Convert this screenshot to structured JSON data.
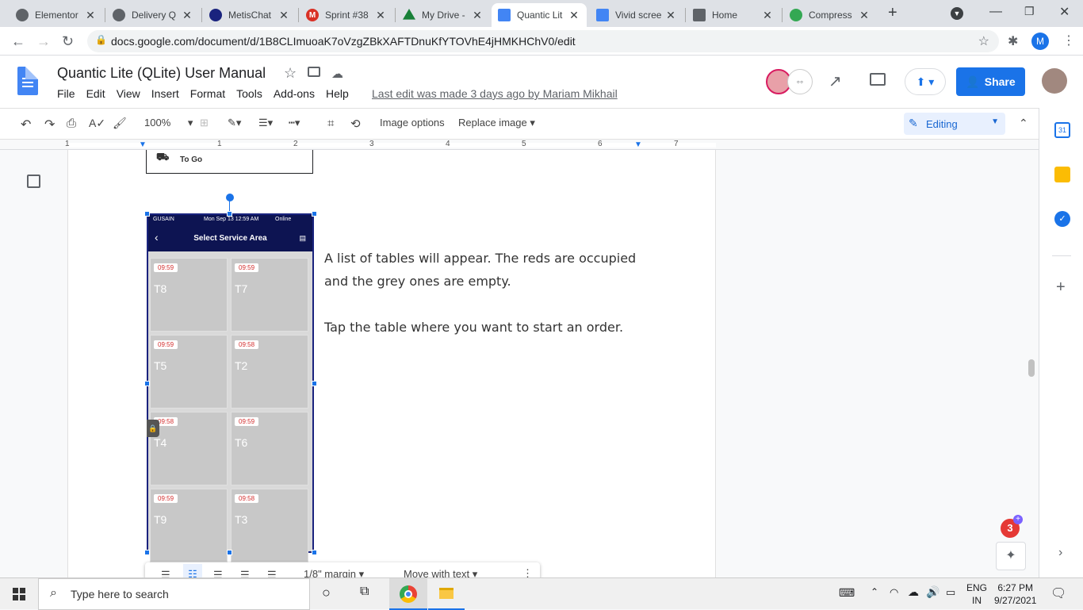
{
  "browser": {
    "tabs": [
      {
        "title": "Elementor",
        "color": "#5f6368"
      },
      {
        "title": "Delivery Q",
        "color": "#5f6368"
      },
      {
        "title": "MetisChat",
        "color": "#1a237e"
      },
      {
        "title": "Sprint #38",
        "color": "#d93025"
      },
      {
        "title": "My Drive -",
        "color": "#188038"
      },
      {
        "title": "Quantic Lit",
        "color": "#4285f4",
        "active": true
      },
      {
        "title": "Vivid scree",
        "color": "#4285f4"
      },
      {
        "title": "Home",
        "color": "#5f6368"
      },
      {
        "title": "Compress",
        "color": "#34a853"
      }
    ],
    "new_tab": "+",
    "url": "docs.google.com/document/d/1B8CLImuoaK7oVzgZBkXAFTDnuKfYTOVhE4jHMKHChV0/edit",
    "profile_initial": "M"
  },
  "doc": {
    "title": "Quantic Lite (QLite) User Manual",
    "menu": [
      "File",
      "Edit",
      "View",
      "Insert",
      "Format",
      "Tools",
      "Add-ons",
      "Help"
    ],
    "last_edit": "Last edit was made 3 days ago by Mariam Mikhail",
    "share_label": "Share"
  },
  "toolbar": {
    "zoom": "100%",
    "image_options": "Image options",
    "replace_image": "Replace image",
    "mode": "Editing"
  },
  "ruler": [
    "1",
    "1",
    "2",
    "3",
    "4",
    "5",
    "6",
    "7"
  ],
  "content": {
    "togo_label": "To Go",
    "phone": {
      "carrier": "GUSAIN",
      "datetime": "Mon Sep 13 12:59 AM",
      "network": "Online",
      "title": "Select Service Area",
      "tables": [
        {
          "time": "09:59",
          "name": "T8"
        },
        {
          "time": "09:59",
          "name": "T7"
        },
        {
          "time": "09:59",
          "name": "T5"
        },
        {
          "time": "09:58",
          "name": "T2"
        },
        {
          "time": "09:58",
          "name": "T4"
        },
        {
          "time": "09:59",
          "name": "T6"
        },
        {
          "time": "09:59",
          "name": "T9"
        },
        {
          "time": "09:58",
          "name": "T3"
        }
      ]
    },
    "para1": "A list of tables will appear. The reds are occupied",
    "para2": "and the grey ones are empty.",
    "para3": "Tap the table where you want to start an order.",
    "image_bar": {
      "margin": "1/8\" margin",
      "wrap": "Move with text"
    },
    "badge_count": "3"
  },
  "taskbar": {
    "search_placeholder": "Type here to search",
    "lang1": "ENG",
    "lang2": "IN",
    "time": "6:27 PM",
    "date": "9/27/2021"
  }
}
